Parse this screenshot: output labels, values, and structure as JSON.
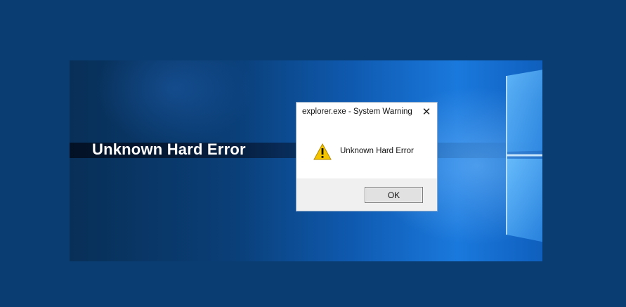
{
  "page": {
    "heading": "Unknown Hard Error"
  },
  "dialog": {
    "title": "explorer.exe - System Warning",
    "message": "Unknown Hard Error",
    "ok_label": "OK",
    "close_icon": "close-icon",
    "message_icon": "warning-icon"
  },
  "colors": {
    "outer_background": "#0a3d71",
    "dialog_background": "#ffffff",
    "dialog_footer": "#f0f0f0",
    "warning_yellow": "#f5c400"
  }
}
